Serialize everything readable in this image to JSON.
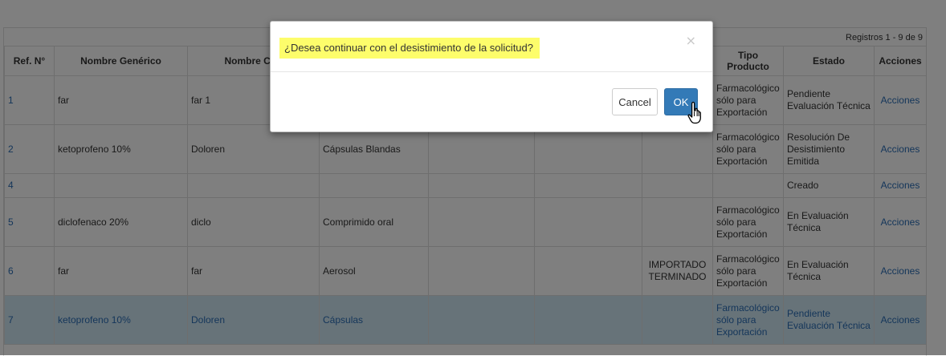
{
  "registros": "Registros 1 - 9 de 9",
  "table": {
    "headers": [
      "Ref. N°",
      "Nombre Genérico",
      "Nombre Con",
      "",
      "",
      "",
      "",
      "Tipo Producto",
      "Estado",
      "Acciones"
    ],
    "rows": [
      {
        "ref": "1",
        "generico": "far",
        "comercial": "far 1",
        "forma": "",
        "c5": "",
        "c6": "",
        "c7": "",
        "tipo": "Farmacológico sólo para Exportación",
        "estado": "Pendiente Evaluación Técnica",
        "acciones": "Acciones"
      },
      {
        "ref": "2",
        "generico": "ketoprofeno 10%",
        "comercial": "Doloren",
        "forma": "Cápsulas Blandas",
        "c5": "",
        "c6": "",
        "c7": "",
        "tipo": "Farmacológico sólo para Exportación",
        "estado": "Resolución De Desistimiento Emitida",
        "acciones": "Acciones"
      },
      {
        "ref": "4",
        "generico": "",
        "comercial": "",
        "forma": "",
        "c5": "",
        "c6": "",
        "c7": "",
        "tipo": "",
        "estado": "Creado",
        "acciones": "Acciones"
      },
      {
        "ref": "5",
        "generico": "diclofenaco 20%",
        "comercial": "diclo",
        "forma": "Comprimido oral",
        "c5": "",
        "c6": "",
        "c7": "",
        "tipo": "Farmacológico sólo para Exportación",
        "estado": "En Evaluación Técnica",
        "acciones": "Acciones"
      },
      {
        "ref": "6",
        "generico": "far",
        "comercial": "far",
        "forma": "Aerosol",
        "c5": "",
        "c6": "",
        "c7": "IMPORTADO TERMINADO",
        "tipo": "Farmacológico sólo para Exportación",
        "estado": "En Evaluación Técnica",
        "acciones": "Acciones"
      },
      {
        "ref": "7",
        "generico": "ketoprofeno 10%",
        "comercial": "Doloren",
        "forma": "Cápsulas",
        "c5": "",
        "c6": "",
        "c7": "",
        "tipo": "Farmacológico sólo para Exportación",
        "estado": "Pendiente Evaluación Técnica",
        "acciones": "Acciones"
      }
    ]
  },
  "modal": {
    "title": "¿Desea continuar con el desistimiento de la solicitud?",
    "close": "×",
    "cancel_label": "Cancel",
    "ok_label": "OK"
  },
  "colors": {
    "link": "#2a6db5",
    "highlight": "#fdfd6b",
    "primary": "#337ab7",
    "selected_row": "#cfe6f3"
  }
}
